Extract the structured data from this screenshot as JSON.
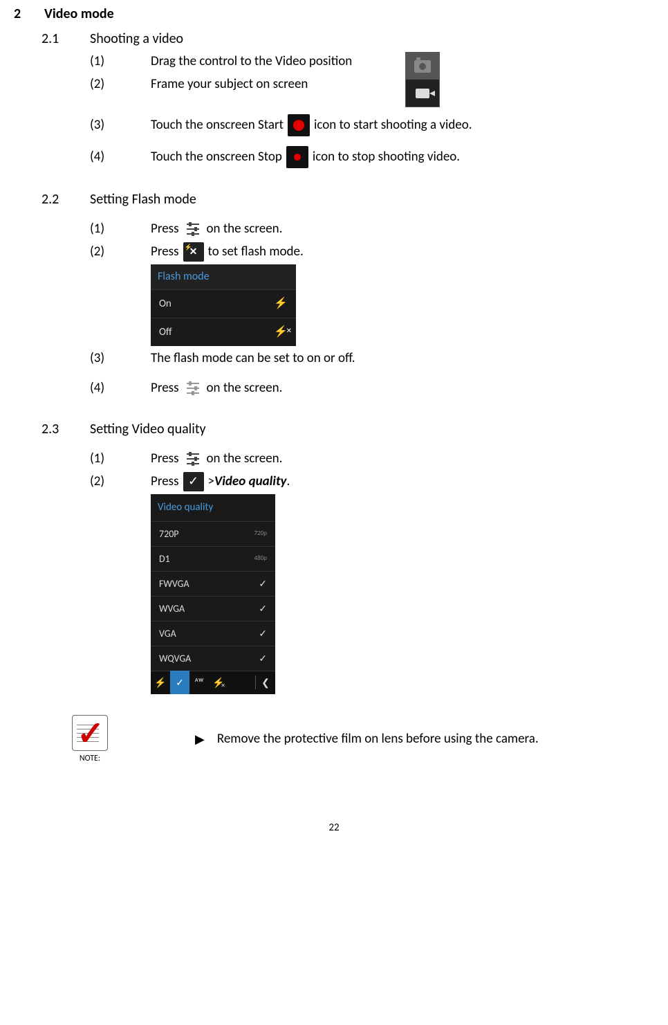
{
  "page_number": "22",
  "section": {
    "num": "2",
    "title": "Video mode"
  },
  "sub1": {
    "num": "2.1",
    "title": "Shooting a video",
    "steps": {
      "s1_num": "(1)",
      "s1": "Drag the control to the Video position",
      "s2_num": "(2)",
      "s2": "Frame your subject on screen",
      "s3_num": "(3)",
      "s3a": "Touch the onscreen Start ",
      "s3b": " icon to start shooting a video.",
      "s4_num": "(4)",
      "s4a": "Touch the onscreen Stop ",
      "s4b": " icon to stop shooting video."
    }
  },
  "sub2": {
    "num": "2.2",
    "title": "Setting Flash mode",
    "steps": {
      "s1_num": "(1)",
      "s1a": "Press ",
      "s1b": " on the screen.",
      "s2_num": "(2)",
      "s2a": "Press ",
      "s2b": " to set flash mode.",
      "s3_num": "(3)",
      "s3": "The flash mode can be set to on or off.",
      "s4_num": "(4)",
      "s4a": "Press ",
      "s4b": " on the screen."
    },
    "flash_shot": {
      "title": "Flash mode",
      "rows": [
        {
          "label": "On",
          "icon": "⚡"
        },
        {
          "label": "Off",
          "icon": "✕"
        }
      ]
    }
  },
  "sub3": {
    "num": "2.3",
    "title": "Setting Video quality",
    "steps": {
      "s1_num": "(1)",
      "s1a": "Press ",
      "s1b": " on the screen.",
      "s2_num": "(2)",
      "s2a": "Press ",
      "s2b": " > ",
      "s2c": "Video quality",
      "s2d": "."
    },
    "vq_shot": {
      "title": "Video quality",
      "rows": [
        {
          "label": "720P",
          "badge": "720p"
        },
        {
          "label": "D1",
          "badge": "480p"
        },
        {
          "label": "FWVGA",
          "check": "✓"
        },
        {
          "label": "WVGA",
          "check": "✓"
        },
        {
          "label": "VGA",
          "check": "✓"
        },
        {
          "label": "WQVGA",
          "check": "✓"
        }
      ],
      "toolbar": {
        "flash_auto": "⚡",
        "check": "✓",
        "aw": "ᴬᵂ",
        "flash_off": "✕",
        "collapse": "❮"
      }
    }
  },
  "note": {
    "label": "NOTE:",
    "bullet": "▶",
    "text": "Remove the protective film on lens before using the camera."
  }
}
